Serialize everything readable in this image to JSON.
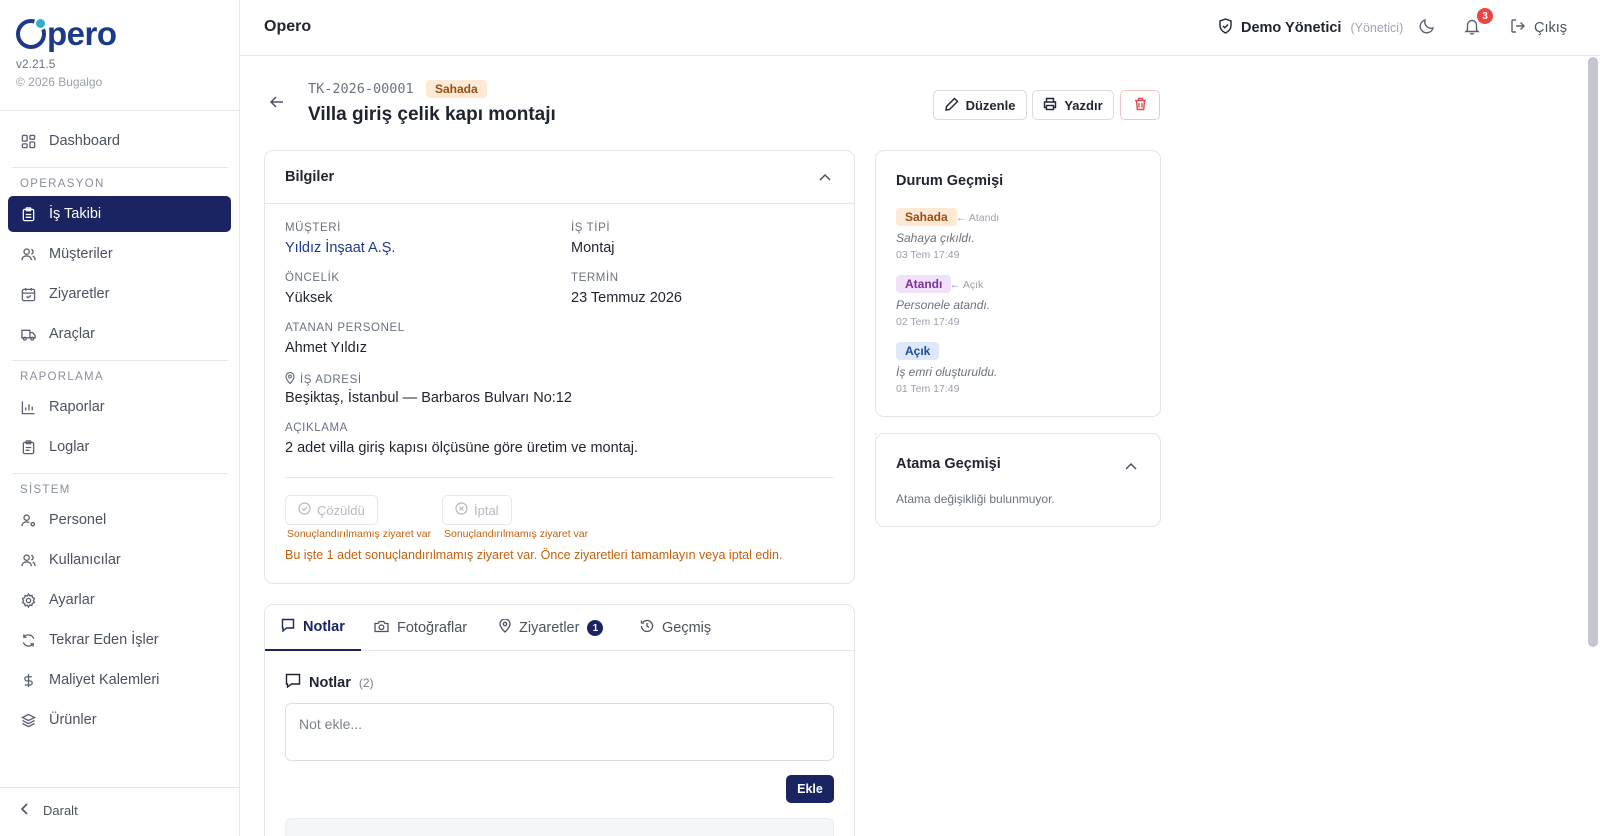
{
  "brand": {
    "logo_text": "pero",
    "version": "v2.21.5",
    "copyright": "© 2026 Bugalgo"
  },
  "sidebar": {
    "dashboard": "Dashboard",
    "sections": {
      "operasyon": "OPERASYON",
      "raporlama": "RAPORLAMA",
      "sistem": "SİSTEM"
    },
    "items": {
      "is_takibi": "İş Takibi",
      "musteriler": "Müşteriler",
      "ziyaretler": "Ziyaretler",
      "araclar": "Araçlar",
      "raporlar": "Raporlar",
      "loglar": "Loglar",
      "personel": "Personel",
      "kullanicilar": "Kullanıcılar",
      "ayarlar": "Ayarlar",
      "tekrar": "Tekrar Eden İşler",
      "maliyet": "Maliyet Kalemleri",
      "urunler": "Ürünler"
    },
    "collapse_label": "Daralt"
  },
  "topbar": {
    "title": "Opero",
    "user_name": "Demo Yönetici",
    "user_role": "(Yönetici)",
    "notification_count": "3",
    "logout_label": "Çıkış"
  },
  "job": {
    "code": "TK-2026-00001",
    "status": "Sahada",
    "title": "Villa giriş çelik kapı montajı",
    "actions": {
      "edit": "Düzenle",
      "print": "Yazdır"
    }
  },
  "info": {
    "title": "Bilgiler",
    "customer_label": "MÜŞTERİ",
    "customer": "Yıldız İnşaat A.Ş.",
    "type_label": "İŞ TİPİ",
    "type": "Montaj",
    "priority_label": "ÖNCELİK",
    "priority": "Yüksek",
    "due_label": "TERMİN",
    "due": "23 Temmuz 2026",
    "assignee_label": "ATANAN PERSONEL",
    "assignee": "Ahmet Yıldız",
    "address_label": "İŞ ADRESİ",
    "address": "Beşiktaş, İstanbul — Barbaros Bulvarı No:12",
    "desc_label": "AÇIKLAMA",
    "desc": "2 adet villa giriş kapısı ölçüsüne göre üretim ve montaj.",
    "resolved_label": "Çözüldü",
    "cancel_label": "İptal",
    "pending_hint": "Sonuçlandırılmamış ziyaret var",
    "warning": "Bu işte 1 adet sonuçlandırılmamış ziyaret var. Önce ziyaretleri tamamlayın veya iptal edin."
  },
  "status_history": {
    "title": "Durum Geçmişi",
    "entries": [
      {
        "status": "Sahada",
        "from": "← Atandı",
        "note": "Sahaya çıkıldı.",
        "date": "03 Tem 17:49"
      },
      {
        "status": "Atandı",
        "from": "← Açık",
        "note": "Personele atandı.",
        "date": "02 Tem 17:49"
      },
      {
        "status": "Açık",
        "note": "İş emri oluşturuldu.",
        "date": "01 Tem 17:49"
      }
    ]
  },
  "assignment_history": {
    "title": "Atama Geçmişi",
    "empty": "Atama değişikliği bulunmuyor."
  },
  "tabs": {
    "notes": "Notlar",
    "photos": "Fotoğraflar",
    "visits": "Ziyaretler",
    "visits_count": "1",
    "history": "Geçmiş"
  },
  "notes": {
    "title": "Notlar",
    "count": "(2)",
    "placeholder": "Not ekle...",
    "add_label": "Ekle"
  },
  "colors": {
    "primary": "#1a2461",
    "brand": "#1d3a8a",
    "warning": "#c2620f",
    "danger": "#ef4444"
  }
}
